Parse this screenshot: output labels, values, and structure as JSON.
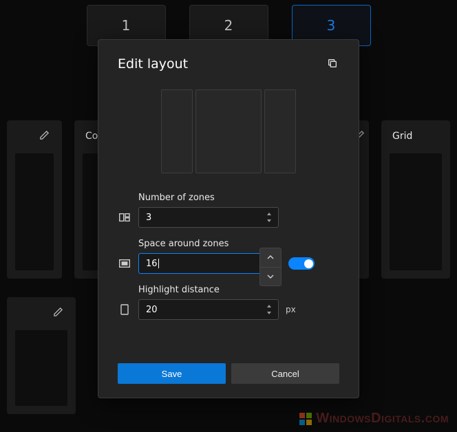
{
  "bg": {
    "tabs": [
      "1",
      "2",
      "3"
    ],
    "cards_row1": {
      "col_label": "Col",
      "grid_label": "Grid"
    }
  },
  "modal": {
    "title": "Edit layout",
    "fields": {
      "zones": {
        "label": "Number of zones",
        "value": "3"
      },
      "space": {
        "label": "Space around zones",
        "value": "16"
      },
      "highlight": {
        "label": "Highlight distance",
        "value": "20",
        "unit": "px"
      }
    },
    "buttons": {
      "save": "Save",
      "cancel": "Cancel"
    }
  },
  "watermark": {
    "text": "WindowsDigitals.com"
  }
}
